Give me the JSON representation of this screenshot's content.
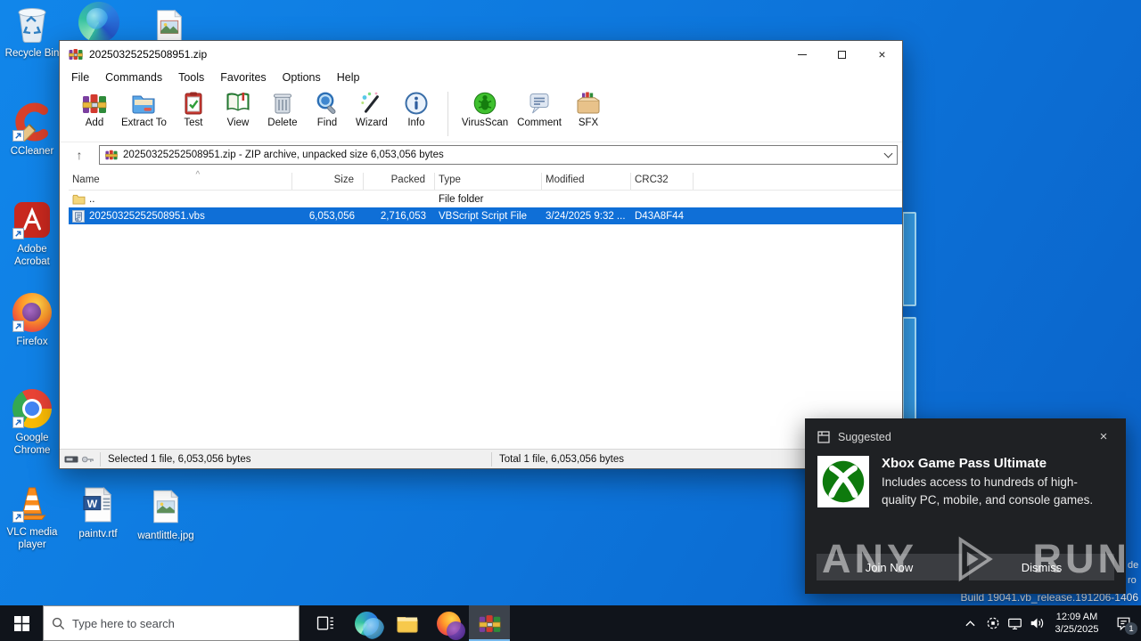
{
  "colors": {
    "desktop_blue": "#0d74da",
    "selection_blue": "#0f6fd7",
    "taskbar_dark": "#10141b",
    "toast_bg": "#1f2124",
    "xbox_green": "#0e7a0d"
  },
  "icons": {
    "close_glyph": "×",
    "up_arrow": "↑",
    "sort_caret": "^"
  },
  "desktop": {
    "icons": [
      {
        "label": "Recycle Bin"
      },
      {
        "label": "CCleaner"
      },
      {
        "label": "Adobe Acrobat"
      },
      {
        "label": "Firefox"
      },
      {
        "label": "Google Chrome"
      },
      {
        "label": "VLC media player"
      }
    ],
    "files": [
      {
        "label": "paintv.rtf"
      },
      {
        "label": "wantlittle.jpg"
      }
    ],
    "build_watermark": "Build 19041.vb_release.191206-1406",
    "edge_fragments": [
      "de",
      "ro"
    ]
  },
  "winrar": {
    "title": "20250325252508951.zip",
    "menu": [
      "File",
      "Commands",
      "Tools",
      "Favorites",
      "Options",
      "Help"
    ],
    "toolbar": [
      "Add",
      "Extract To",
      "Test",
      "View",
      "Delete",
      "Find",
      "Wizard",
      "Info",
      "VirusScan",
      "Comment",
      "SFX"
    ],
    "address": "20250325252508951.zip - ZIP archive, unpacked size 6,053,056 bytes",
    "columns": [
      "Name",
      "Size",
      "Packed",
      "Type",
      "Modified",
      "CRC32"
    ],
    "rows": [
      {
        "name": "..",
        "size": "",
        "packed": "",
        "type": "File folder",
        "modified": "",
        "crc32": ""
      },
      {
        "name": "20250325252508951.vbs",
        "size": "6,053,056",
        "packed": "2,716,053",
        "type": "VBScript Script File",
        "modified": "3/24/2025 9:32 ...",
        "crc32": "D43A8F44"
      }
    ],
    "status": {
      "selected": "Selected 1 file, 6,053,056 bytes",
      "total": "Total 1 file, 6,053,056 bytes"
    }
  },
  "toast": {
    "header": "Suggested",
    "title": "Xbox Game Pass Ultimate",
    "body": "Includes access to hundreds of high-quality PC, mobile, and console games.",
    "join_label": "Join Now",
    "dismiss_label": "Dismiss"
  },
  "taskbar": {
    "search_placeholder": "Type here to search",
    "clock_time": "12:09 AM",
    "clock_date": "3/25/2025",
    "notification_count": "1"
  },
  "watermark": {
    "left": "ANY",
    "right": "RUN"
  }
}
